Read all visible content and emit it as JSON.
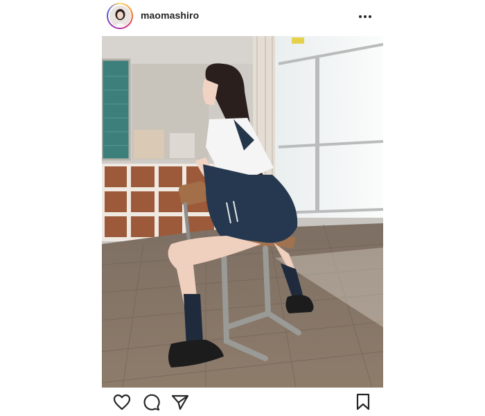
{
  "post": {
    "username": "maomashiro",
    "photo_alt": "",
    "colors": {
      "ring_gradient": [
        "#feda75",
        "#fa7e1e",
        "#d62976",
        "#962fbf",
        "#4f5bd5"
      ],
      "icon": "#262626",
      "text": "#262626"
    }
  },
  "icons": {
    "more": "more-options-icon",
    "like": "heart-icon",
    "comment": "comment-bubble-icon",
    "share": "paper-plane-icon",
    "save": "bookmark-icon"
  }
}
